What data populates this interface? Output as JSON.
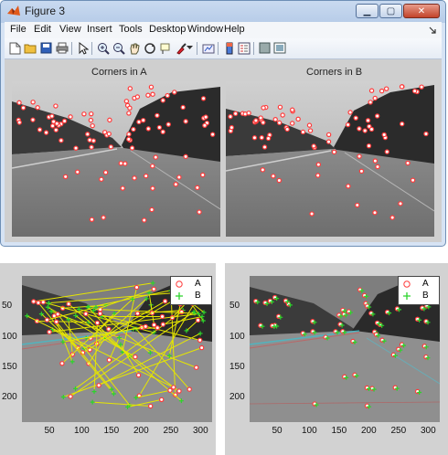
{
  "window": {
    "title": "Figure 3"
  },
  "menu": [
    "File",
    "Edit",
    "View",
    "Insert",
    "Tools",
    "Desktop",
    "Window",
    "Help"
  ],
  "toolbar_icons": [
    "new-figure-icon",
    "open-file-icon",
    "save-icon",
    "print-icon",
    "pointer-icon",
    "zoom-in-icon",
    "zoom-out-icon",
    "pan-icon",
    "rotate-3d-icon",
    "data-cursor-icon",
    "brush-icon",
    "link-plot-icon",
    "colorbar-icon",
    "legend-icon",
    "hide-plot-tools-icon",
    "show-plot-tools-icon"
  ],
  "axes": {
    "titleA": "Corners in A",
    "titleB": "Corners in B"
  },
  "plots": {
    "legend": [
      "A",
      "B"
    ],
    "x_ticks": [
      "50",
      "100",
      "150",
      "200",
      "250",
      "300"
    ],
    "y_ticks": [
      "50",
      "100",
      "150",
      "200"
    ],
    "xlim": [
      0,
      320
    ],
    "ylim": [
      0,
      240
    ]
  },
  "colors": {
    "A": "#ff3b3b",
    "B": "#2bd42b",
    "match_line": "#e6e600"
  }
}
